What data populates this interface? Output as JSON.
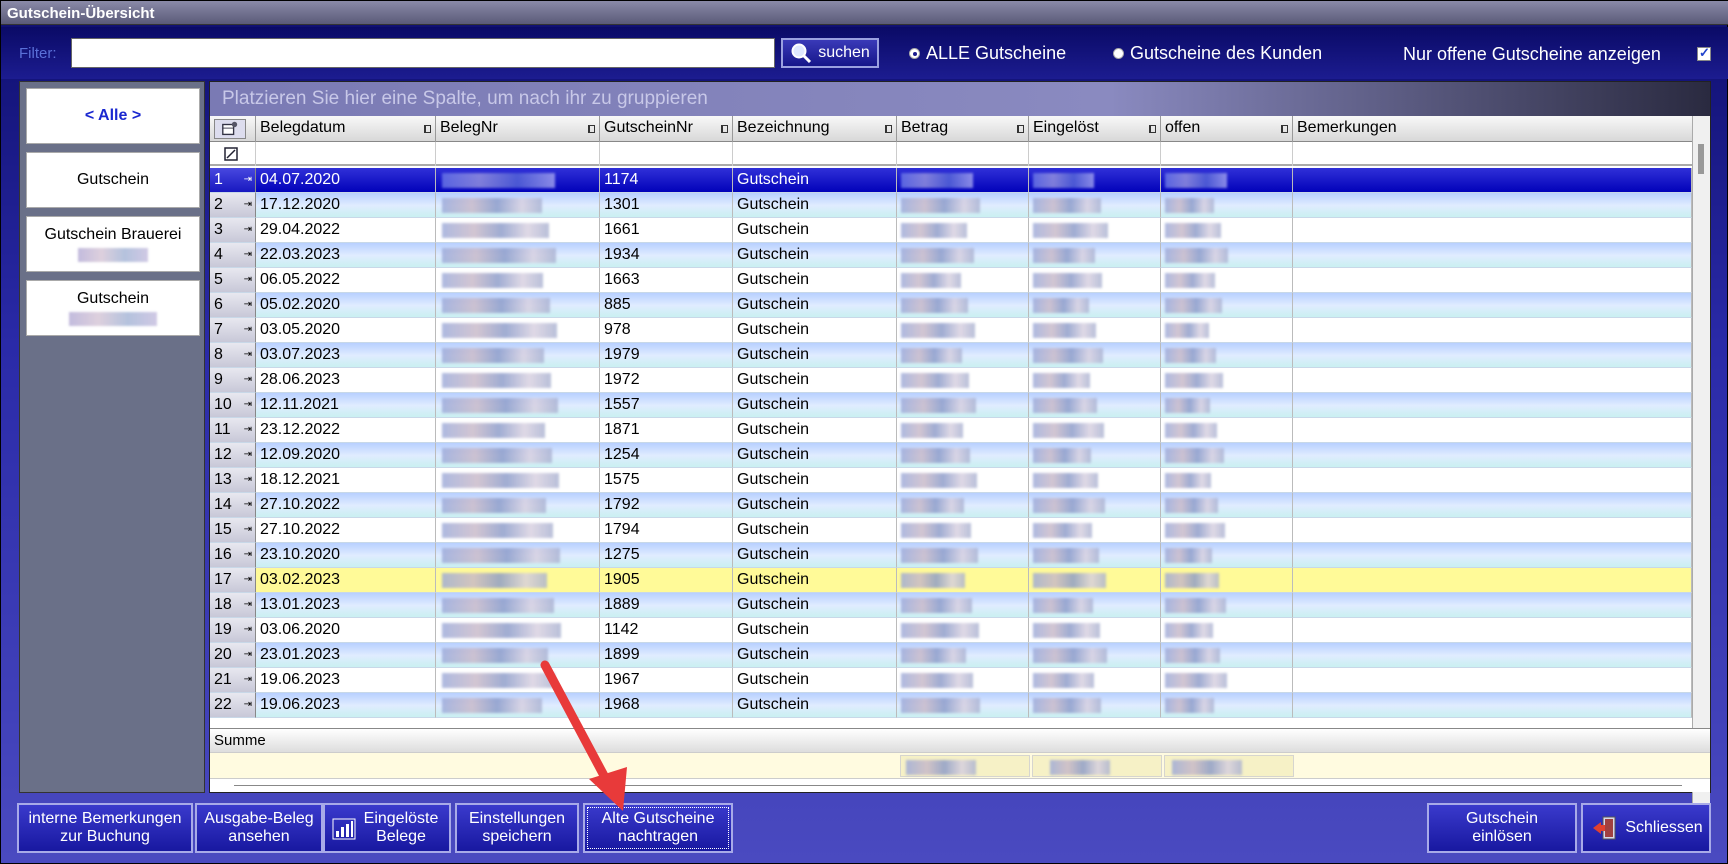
{
  "window": {
    "title": "Gutschein-Übersicht"
  },
  "toolbar": {
    "filter_label": "Filter:",
    "filter_value": "",
    "search_label": "suchen",
    "radio_all": "ALLE Gutscheine",
    "radio_customer": "Gutscheine des Kunden",
    "only_open_label": "Nur offene Gutscheine anzeigen",
    "only_open_checked": true
  },
  "sidebar": {
    "items": [
      {
        "label": "< Alle >"
      },
      {
        "label": "Gutschein"
      },
      {
        "label": "Gutschein Brauerei"
      },
      {
        "label": "Gutschein"
      }
    ]
  },
  "grid": {
    "group_hint": "Platzieren Sie hier eine Spalte, um nach ihr zu gruppieren",
    "columns": [
      "Belegdatum",
      "BelegNr",
      "GutscheinNr",
      "Bezeichnung",
      "Betrag",
      "Eingelöst",
      "offen",
      "Bemerkungen"
    ],
    "rows": [
      {
        "n": "1",
        "date": "04.07.2020",
        "nr": "1174",
        "bez": "Gutschein"
      },
      {
        "n": "2",
        "date": "17.12.2020",
        "nr": "1301",
        "bez": "Gutschein"
      },
      {
        "n": "3",
        "date": "29.04.2022",
        "nr": "1661",
        "bez": "Gutschein"
      },
      {
        "n": "4",
        "date": "22.03.2023",
        "nr": "1934",
        "bez": "Gutschein"
      },
      {
        "n": "5",
        "date": "06.05.2022",
        "nr": "1663",
        "bez": "Gutschein"
      },
      {
        "n": "6",
        "date": "05.02.2020",
        "nr": "885",
        "bez": "Gutschein"
      },
      {
        "n": "7",
        "date": "03.05.2020",
        "nr": "978",
        "bez": "Gutschein"
      },
      {
        "n": "8",
        "date": "03.07.2023",
        "nr": "1979",
        "bez": "Gutschein"
      },
      {
        "n": "9",
        "date": "28.06.2023",
        "nr": "1972",
        "bez": "Gutschein"
      },
      {
        "n": "10",
        "date": "12.11.2021",
        "nr": "1557",
        "bez": "Gutschein"
      },
      {
        "n": "11",
        "date": "23.12.2022",
        "nr": "1871",
        "bez": "Gutschein"
      },
      {
        "n": "12",
        "date": "12.09.2020",
        "nr": "1254",
        "bez": "Gutschein"
      },
      {
        "n": "13",
        "date": "18.12.2021",
        "nr": "1575",
        "bez": "Gutschein"
      },
      {
        "n": "14",
        "date": "27.10.2022",
        "nr": "1792",
        "bez": "Gutschein"
      },
      {
        "n": "15",
        "date": "27.10.2022",
        "nr": "1794",
        "bez": "Gutschein"
      },
      {
        "n": "16",
        "date": "23.10.2020",
        "nr": "1275",
        "bez": "Gutschein"
      },
      {
        "n": "17",
        "date": "03.02.2023",
        "nr": "1905",
        "bez": "Gutschein"
      },
      {
        "n": "18",
        "date": "13.01.2023",
        "nr": "1889",
        "bez": "Gutschein"
      },
      {
        "n": "19",
        "date": "03.06.2020",
        "nr": "1142",
        "bez": "Gutschein"
      },
      {
        "n": "20",
        "date": "23.01.2023",
        "nr": "1899",
        "bez": "Gutschein"
      },
      {
        "n": "21",
        "date": "19.06.2023",
        "nr": "1967",
        "bez": "Gutschein"
      },
      {
        "n": "22",
        "date": "19.06.2023",
        "nr": "1968",
        "bez": "Gutschein"
      }
    ],
    "sum_label": "Summe"
  },
  "buttons": {
    "internal_notes": [
      "interne Bemerkungen",
      "zur Buchung"
    ],
    "view_receipt": [
      "Ausgabe-Beleg",
      "ansehen"
    ],
    "redeemed": [
      "Eingelöste",
      "Belege"
    ],
    "save_settings": [
      "Einstellungen",
      "speichern"
    ],
    "add_old": [
      "Alte Gutscheine",
      "nachtragen"
    ],
    "redeem": [
      "Gutschein",
      "einlösen"
    ],
    "close": "Schliessen"
  },
  "colors": {
    "selected_row": "#0000b8",
    "highlight_row": "#fffa98",
    "accent_arrow": "#e83a3a"
  },
  "icons": [
    "search-icon",
    "bar-chart-icon",
    "exit-door-icon",
    "column-chooser-icon",
    "filter-clear-icon"
  ]
}
